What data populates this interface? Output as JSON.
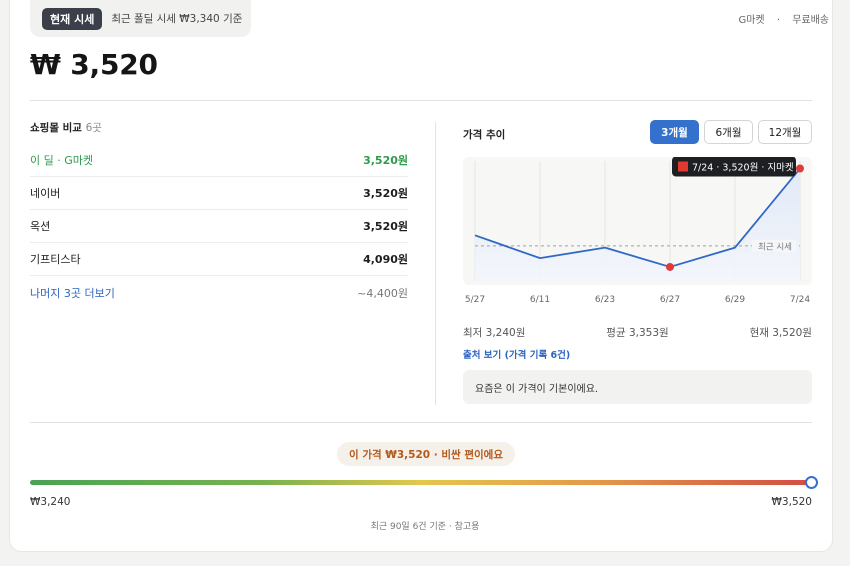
{
  "header": {
    "badge": "현재 시세",
    "note": "최근 폴딜 시세 ₩3,340 기준",
    "seller": "G마켓",
    "shipping": "무료배송"
  },
  "price": "₩ 3,520",
  "comparison": {
    "title": "쇼핑몰 비교",
    "count": "6곳",
    "rows": [
      {
        "name": "이 딜 · G마켓",
        "price": "3,520원"
      },
      {
        "name": "네이버",
        "price": "3,520원"
      },
      {
        "name": "옥션",
        "price": "3,520원"
      },
      {
        "name": "기프티스타",
        "price": "4,090원"
      }
    ],
    "more": {
      "label": "나머지 3곳 더보기",
      "price": "~4,400원"
    }
  },
  "trend": {
    "title": "가격 추이",
    "tabs": [
      "3개월",
      "6개월",
      "12개월"
    ],
    "active_tab": "3개월",
    "stats": {
      "min": "최저 3,240원",
      "avg": "평균 3,353원",
      "cur": "현재 3,520원"
    },
    "source_link": "출처 보기 (가격 기록 6건)",
    "message": "요즘은 이 가격이 기본이에요."
  },
  "chart_data": {
    "type": "line",
    "x": [
      "5/27",
      "6/11",
      "6/23",
      "6/27",
      "6/29",
      "7/24"
    ],
    "values": [
      3330,
      3265,
      3295,
      3240,
      3295,
      3520
    ],
    "ylim": [
      3200,
      3530
    ],
    "reference": {
      "label": "최근 시세",
      "value": 3300
    },
    "tooltip": "7/24 · 3,520원 · 지마켓",
    "line_color": "#2f68c6",
    "marker_color": "#e03b3b",
    "grid": true
  },
  "verdict": "이 가격 ₩3,520 · 비싼 편이에요",
  "range": {
    "min": "₩3,240",
    "max": "₩3,520",
    "position": 1.0
  },
  "footnote": "최근 90일 6건 기준 · 참고용"
}
